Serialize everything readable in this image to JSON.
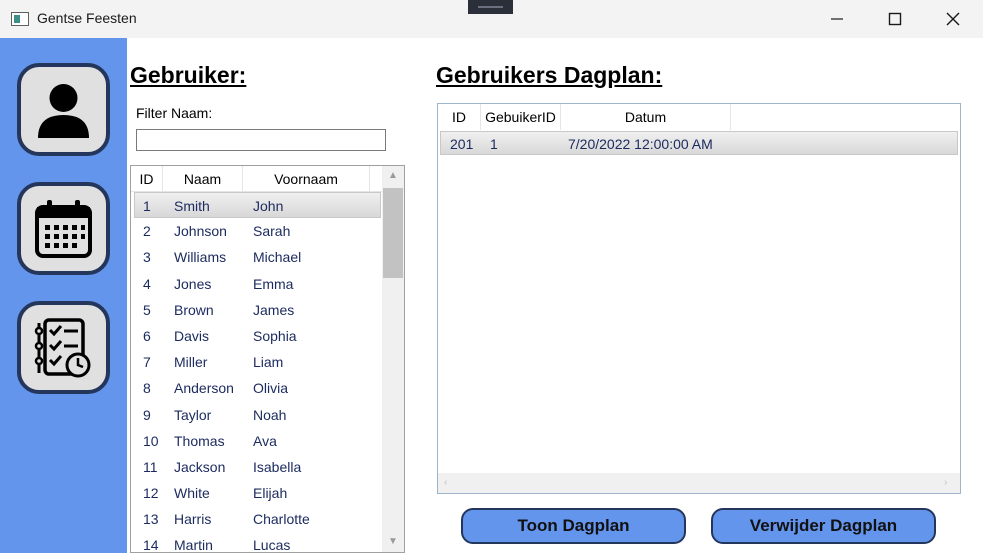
{
  "window": {
    "title": "Gentse Feesten",
    "icons": {
      "app": "app-window-icon",
      "minimize": "minimize-icon",
      "maximize": "maximize-icon",
      "close": "close-icon"
    }
  },
  "sidebar": {
    "items": [
      {
        "name": "user-icon"
      },
      {
        "name": "calendar-icon"
      },
      {
        "name": "task-checklist-icon"
      }
    ],
    "color": "#6495ed"
  },
  "users_panel": {
    "heading": "Gebruiker:",
    "filter_label": "Filter Naam:",
    "filter_value": "",
    "columns": [
      "ID",
      "Naam",
      "Voornaam"
    ],
    "selected_index": 0,
    "rows": [
      {
        "id": "1",
        "naam": "Smith",
        "voornaam": "John"
      },
      {
        "id": "2",
        "naam": "Johnson",
        "voornaam": "Sarah"
      },
      {
        "id": "3",
        "naam": "Williams",
        "voornaam": "Michael"
      },
      {
        "id": "4",
        "naam": "Jones",
        "voornaam": "Emma"
      },
      {
        "id": "5",
        "naam": "Brown",
        "voornaam": "James"
      },
      {
        "id": "6",
        "naam": "Davis",
        "voornaam": "Sophia"
      },
      {
        "id": "7",
        "naam": "Miller",
        "voornaam": "Liam"
      },
      {
        "id": "8",
        "naam": "Anderson",
        "voornaam": "Olivia"
      },
      {
        "id": "9",
        "naam": "Taylor",
        "voornaam": "Noah"
      },
      {
        "id": "10",
        "naam": "Thomas",
        "voornaam": "Ava"
      },
      {
        "id": "11",
        "naam": "Jackson",
        "voornaam": "Isabella"
      },
      {
        "id": "12",
        "naam": "White",
        "voornaam": "Elijah"
      },
      {
        "id": "13",
        "naam": "Harris",
        "voornaam": "Charlotte"
      },
      {
        "id": "14",
        "naam": "Martin",
        "voornaam": "Lucas"
      }
    ]
  },
  "plan_panel": {
    "heading": "Gebruikers Dagplan:",
    "columns": [
      "ID",
      "GebuikerID",
      "Datum"
    ],
    "rows": [
      {
        "id": "201",
        "gebruiker_id": "1",
        "datum": "7/20/2022 12:00:00 AM"
      }
    ]
  },
  "buttons": {
    "toon": "Toon Dagplan",
    "verwijder": "Verwijder Dagplan"
  }
}
